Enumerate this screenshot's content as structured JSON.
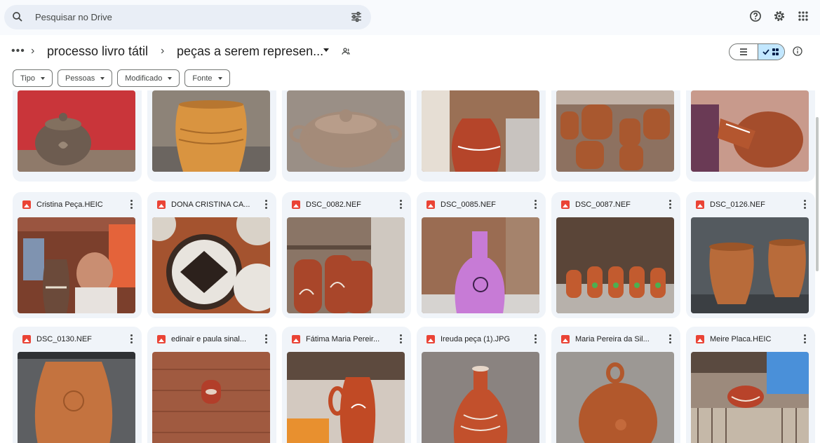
{
  "search": {
    "placeholder": "Pesquisar no Drive"
  },
  "breadcrumb": {
    "more": "•••",
    "items": [
      "processo livro tátil",
      "peças a serem represen..."
    ]
  },
  "filters": [
    "Tipo",
    "Pessoas",
    "Modificado",
    "Fonte"
  ],
  "rows": [
    {
      "files": [
        "",
        "",
        "",
        "",
        "",
        ""
      ]
    },
    {
      "files": [
        "Cristina Peça.HEIC",
        "DONA CRISTINA CA...",
        "DSC_0082.NEF",
        "DSC_0085.NEF",
        "DSC_0087.NEF",
        "DSC_0126.NEF"
      ]
    },
    {
      "files": [
        "DSC_0130.NEF",
        "edinair e paula sinal...",
        "Fátima Maria Pereir...",
        "Ireuda peça (1).JPG",
        "Maria Pereira da Sil...",
        "Meire Placa.HEIC"
      ]
    }
  ],
  "icons": {
    "search": "search-icon",
    "tune": "tune-icon",
    "help": "help-icon",
    "settings": "gear-icon",
    "apps": "apps-grid-icon",
    "shared": "shared-folder-icon",
    "list": "list-view-icon",
    "grid": "grid-view-icon",
    "info": "info-icon",
    "file": "image-file-icon",
    "more": "more-vert-icon"
  },
  "colors": {
    "accent": "#c2e7ff",
    "file_icon": "#ea4335",
    "card": "#f0f4f9",
    "search_bg": "#e9eef6"
  }
}
